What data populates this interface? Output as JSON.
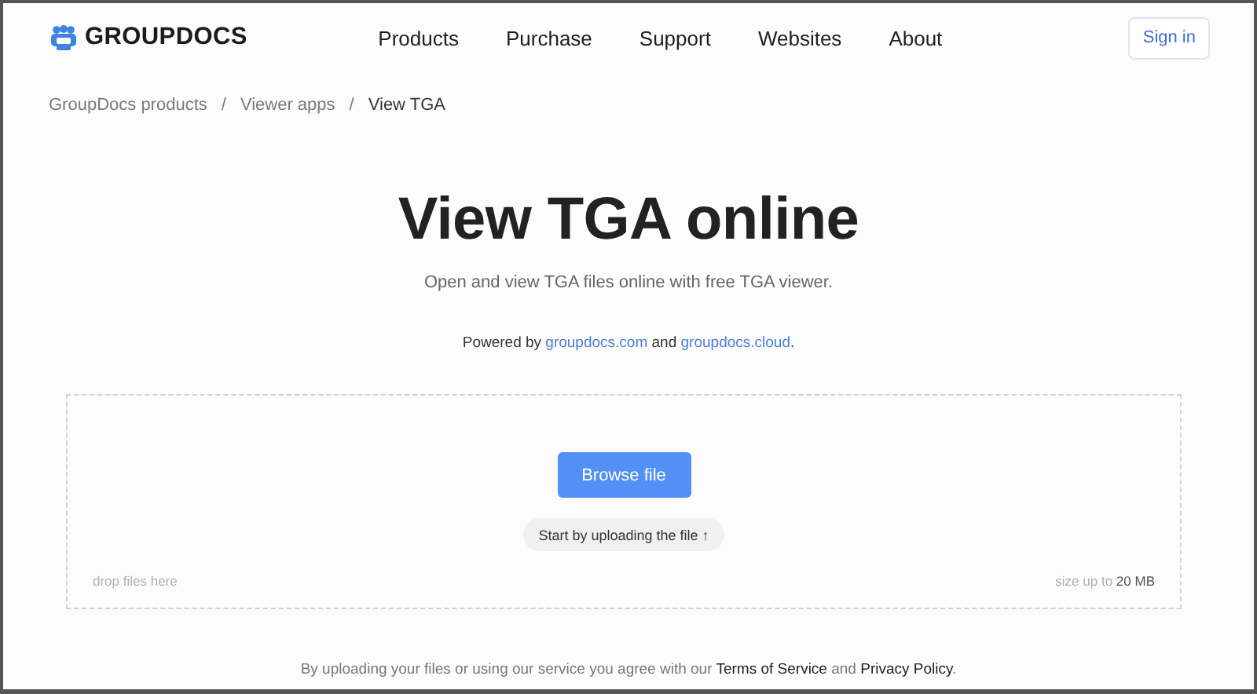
{
  "header": {
    "logo": "GROUPDOCS",
    "nav": [
      "Products",
      "Purchase",
      "Support",
      "Websites",
      "About"
    ],
    "sign_in": "Sign in"
  },
  "breadcrumb": [
    {
      "label": "GroupDocs products",
      "current": false
    },
    {
      "label": "Viewer apps",
      "current": false
    },
    {
      "label": "View TGA",
      "current": true
    }
  ],
  "breadcrumb_separator": "/",
  "title": "View TGA online",
  "subtitle": "Open and view TGA files online with free TGA viewer.",
  "powered": [
    {
      "kind": "text",
      "text": "Powered by "
    },
    {
      "kind": "link",
      "text": "groupdocs.com"
    },
    {
      "kind": "text",
      "text": " and "
    },
    {
      "kind": "link",
      "text": "groupdocs.cloud"
    },
    {
      "kind": "text",
      "text": "."
    }
  ],
  "upload": {
    "button": "Browse file",
    "hint": "Start by uploading the file ↑",
    "drop": "drop files here",
    "size": [
      {
        "kind": "text",
        "text": "size up to "
      },
      {
        "kind": "value",
        "text": "20 MB"
      }
    ]
  },
  "footer": [
    {
      "kind": "text",
      "text": "By uploading your files or using our service you agree with our "
    },
    {
      "kind": "link",
      "text": "Terms of Service"
    },
    {
      "kind": "text",
      "text": " and "
    },
    {
      "kind": "link",
      "text": "Privacy Policy"
    },
    {
      "kind": "text",
      "text": "."
    }
  ]
}
